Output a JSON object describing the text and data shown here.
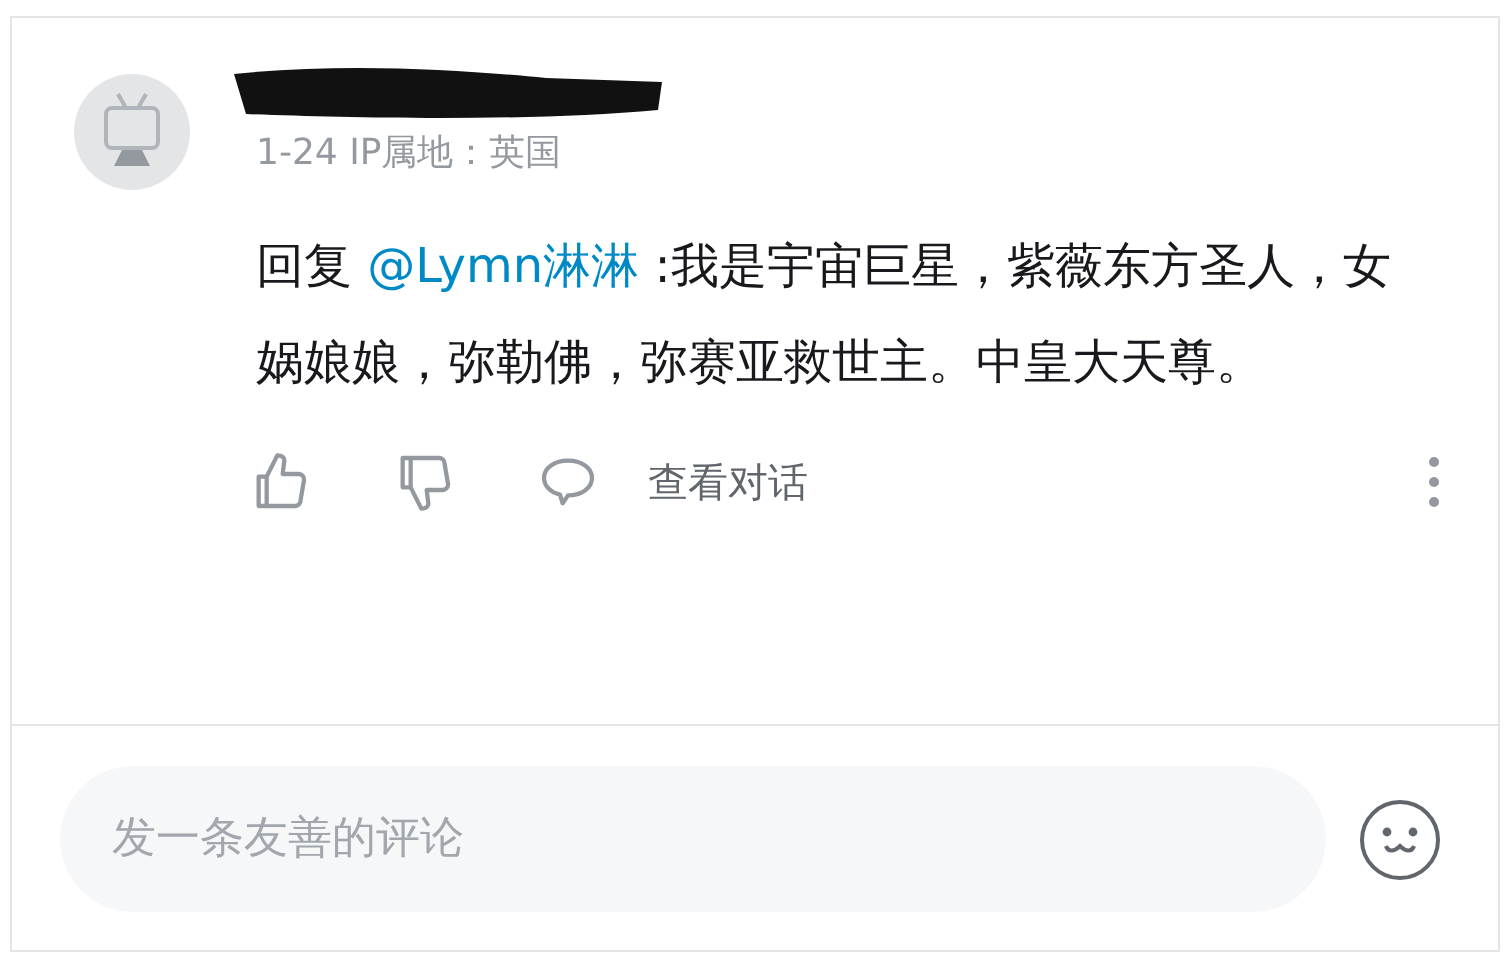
{
  "comment": {
    "meta": "1-24 IP属地：英国",
    "reply_prefix": "回复",
    "mention": "@Lymn淋淋",
    "text": ":我是宇宙巨星，紫薇东方圣人，女娲娘娘，弥勒佛，弥赛亚救世主。中皇大天尊。",
    "view_conversation": "查看对话"
  },
  "composer": {
    "placeholder": "发一条友善的评论"
  }
}
